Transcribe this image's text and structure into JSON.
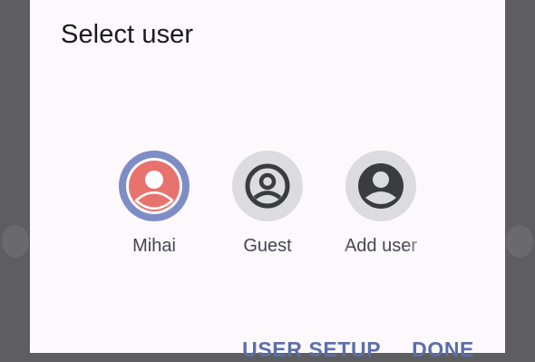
{
  "dialog": {
    "title": "Select user",
    "users": [
      {
        "name": "Mihai",
        "avatar_icon": "person-avatar-icon",
        "selected": true
      },
      {
        "name": "Guest",
        "avatar_icon": "account-circle-icon",
        "selected": false
      },
      {
        "name": "Add user",
        "avatar_icon": "account-circle-icon",
        "selected": false
      }
    ],
    "actions": {
      "user_setup": "USER SETUP",
      "done": "DONE"
    }
  },
  "colors": {
    "selected_ring": "#7e8dc6",
    "selected_avatar": "#e8726e",
    "unselected_bg": "#dcdbe0",
    "action_text": "#5a6fa8"
  }
}
